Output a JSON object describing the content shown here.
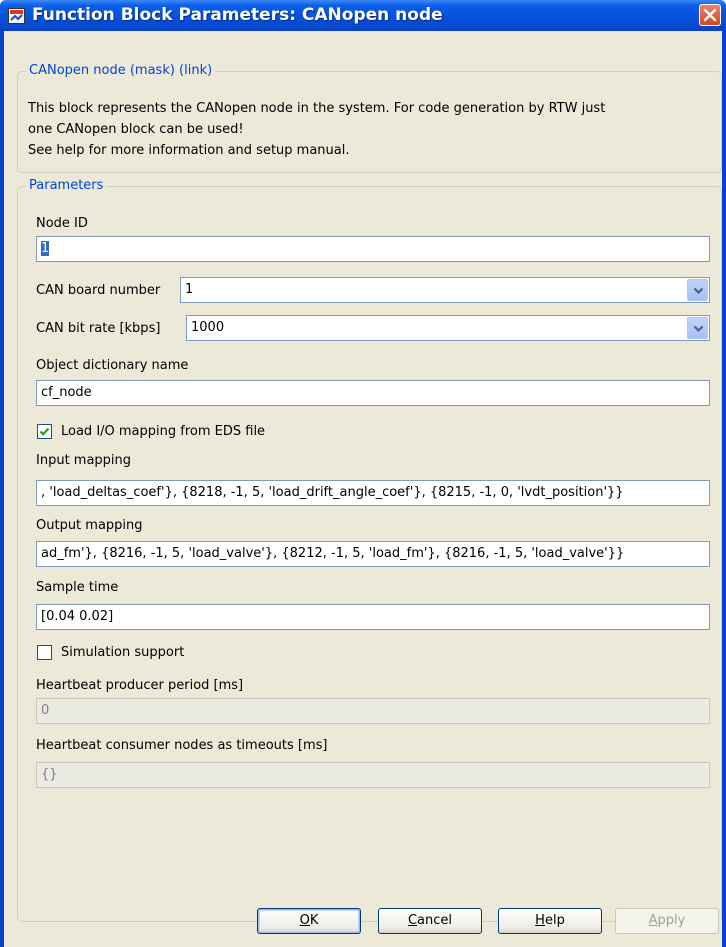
{
  "window": {
    "title": "Function Block Parameters: CANopen node",
    "close_icon": "close-icon"
  },
  "description_group": {
    "legend": "CANopen node (mask) (link)",
    "lines": [
      "This block represents the CANopen node in the system. For code generation by RTW just",
      "one CANopen block can be used!",
      "See help for more information and setup manual."
    ]
  },
  "parameters": {
    "legend": "Parameters",
    "node_id": {
      "label": "Node ID",
      "value": "1"
    },
    "can_board_number": {
      "label": "CAN board number",
      "value": "1"
    },
    "can_bit_rate": {
      "label": "CAN bit rate [kbps]",
      "value": "1000"
    },
    "object_dictionary_name": {
      "label": "Object dictionary name",
      "value": "cf_node"
    },
    "load_io_mapping": {
      "label": "Load I/O mapping from EDS file",
      "checked": true
    },
    "input_mapping": {
      "label": "Input mapping",
      "value": ", 'load_deltas_coef'}, {8218, -1, 5, 'load_drift_angle_coef'}, {8215, -1, 0, 'lvdt_position'}}"
    },
    "output_mapping": {
      "label": "Output mapping",
      "value": "ad_fm'}, {8216, -1, 5, 'load_valve'}, {8212, -1, 5, 'load_fm'}, {8216, -1, 5, 'load_valve'}}"
    },
    "sample_time": {
      "label": "Sample time",
      "value": "[0.04 0.02]"
    },
    "simulation_support": {
      "label": "Simulation support",
      "checked": false
    },
    "heartbeat_producer": {
      "label": "Heartbeat producer period [ms]",
      "value": "0"
    },
    "heartbeat_consumer": {
      "label": "Heartbeat consumer nodes as timeouts [ms]",
      "value": "{}"
    }
  },
  "buttons": {
    "ok": {
      "label": "OK",
      "mnemonic": "O",
      "rest": "K"
    },
    "cancel": {
      "label": "Cancel",
      "mnemonic": "C",
      "rest": "ancel"
    },
    "help": {
      "label": "Help",
      "mnemonic": "H",
      "rest": "elp"
    },
    "apply": {
      "label": "Apply",
      "mnemonic": "A",
      "rest": "pply"
    }
  },
  "colors": {
    "titlebar": "#0652dc",
    "client": "#ece9d8",
    "legend_text": "#0046d5"
  }
}
